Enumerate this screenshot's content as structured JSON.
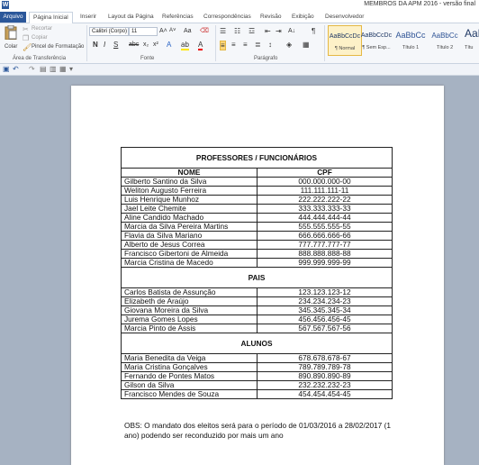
{
  "window": {
    "title": "MEMBROS DA APM 2016 - versão final"
  },
  "tabs": {
    "file": "Arquivo",
    "items": [
      "Página Inicial",
      "Inserir",
      "Layout da Página",
      "Referências",
      "Correspondências",
      "Revisão",
      "Exibição",
      "Desenvolvedor"
    ]
  },
  "ribbon": {
    "clipboard": {
      "paste": "Colar",
      "cut": "Recortar",
      "copy": "Copiar",
      "format_painter": "Pincel de Formatação",
      "group": "Área de Transferência"
    },
    "font": {
      "font_name": "Calibri (Corpo)",
      "font_size": "11",
      "group": "Fonte"
    },
    "paragraph": {
      "group": "Parágrafo"
    },
    "styles": [
      {
        "sample": "AaBbCcDc",
        "name": "¶ Normal"
      },
      {
        "sample": "AaBbCcDc",
        "name": "¶ Sem Esp..."
      },
      {
        "sample": "AaBbCc",
        "name": "Título 1"
      },
      {
        "sample": "AaBbCc",
        "name": "Título 2"
      },
      {
        "sample": "AaB",
        "name": "Títu"
      }
    ]
  },
  "doc": {
    "title": "PROFESSORES / FUNCIONÁRIOS",
    "col_name": "NOME",
    "col_cpf": "CPF",
    "staff": [
      {
        "name": "Gilberto Santino da Silva",
        "cpf": "000.000.000-00"
      },
      {
        "name": "Weliton Augusto Ferreira",
        "cpf": "111.111.111-11"
      },
      {
        "name": "Luis Henrique Munhoz",
        "cpf": "222.222.222-22"
      },
      {
        "name": "Jael Leite Chemite",
        "cpf": "333.333.333-33"
      },
      {
        "name": "Aline Candido Machado",
        "cpf": "444.444.444-44"
      },
      {
        "name": "Marcia da Silva Pereira Martins",
        "cpf": "555.555.555-55"
      },
      {
        "name": "Flavia da Silva Mariano",
        "cpf": "666.666.666-66"
      },
      {
        "name": "Alberto de Jesus Correa",
        "cpf": "777.777.777-77"
      },
      {
        "name": "Francisco Gibertoni de Almeida",
        "cpf": "888.888.888-88"
      },
      {
        "name": "Marcia Cristina de Macedo",
        "cpf": "999.999.999-99"
      }
    ],
    "parents_title": "PAIS",
    "parents": [
      {
        "name": "Carlos Batista de Assunção",
        "cpf": "123.123.123-12"
      },
      {
        "name": "Elizabeth de Araújo",
        "cpf": "234.234.234-23"
      },
      {
        "name": "Giovana Moreira da Silva",
        "cpf": "345.345.345-34"
      },
      {
        "name": "Jurema Gomes Lopes",
        "cpf": "456.456.456-45"
      },
      {
        "name": "Marcia Pinto de Assis",
        "cpf": "567.567.567-56"
      }
    ],
    "students_title": "ALUNOS",
    "students": [
      {
        "name": "Maria Benedita da Veiga",
        "cpf": "678.678.678-67"
      },
      {
        "name": "Maria Cristina Gonçalves",
        "cpf": "789.789.789-78"
      },
      {
        "name": "Fernando de Pontes Matos",
        "cpf": "890.890.890-89"
      },
      {
        "name": "Gilson da Silva",
        "cpf": "232.232.232-23"
      },
      {
        "name": "Francisco Mendes de Souza",
        "cpf": "454.454.454-45"
      }
    ],
    "obs": "OBS: O mandato dos eleitos será para o período de 01/03/2016 a 28/02/2017 (1 ano) podendo ser reconduzido por mais um ano"
  }
}
